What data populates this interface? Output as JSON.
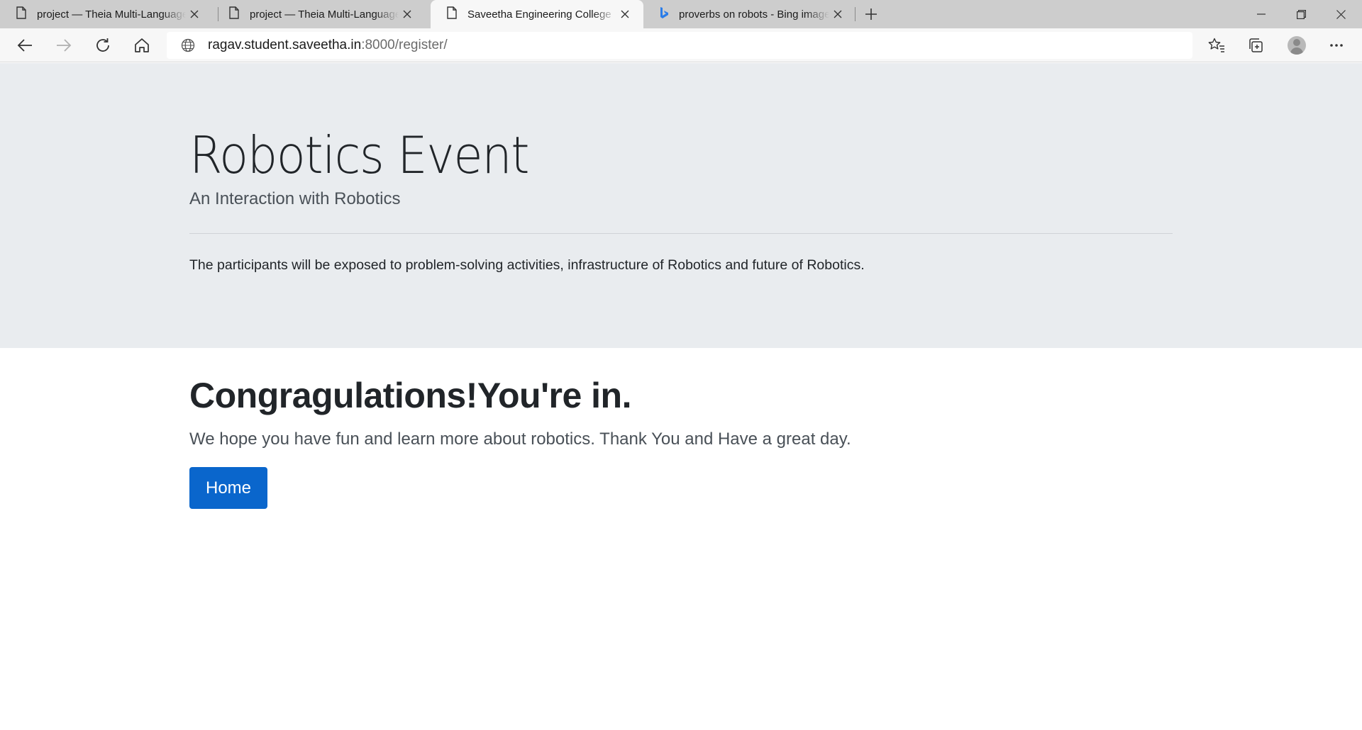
{
  "browser": {
    "tabs": [
      {
        "title": "project — Theia Multi-Language",
        "icon": "page-icon",
        "active": false
      },
      {
        "title": "project — Theia Multi-Language",
        "icon": "page-icon",
        "active": false
      },
      {
        "title": "Saveetha Engineering College",
        "icon": "page-icon",
        "active": true
      },
      {
        "title": "proverbs on robots - Bing images",
        "icon": "bing-icon",
        "active": false
      }
    ],
    "address": {
      "host": "ragav.student.saveetha.in",
      "rest": ":8000/register/"
    }
  },
  "jumbotron": {
    "title": "Robotics Event",
    "lead": "An Interaction with Robotics",
    "text": "The participants will be exposed to problem-solving activities, infrastructure of Robotics and future of Robotics."
  },
  "main": {
    "heading": "Congragulations!You're in.",
    "subtext": "We hope you have fun and learn more about robotics. Thank You and Have a great day.",
    "home_button": "Home",
    "accent_color": "#0a66cc"
  }
}
